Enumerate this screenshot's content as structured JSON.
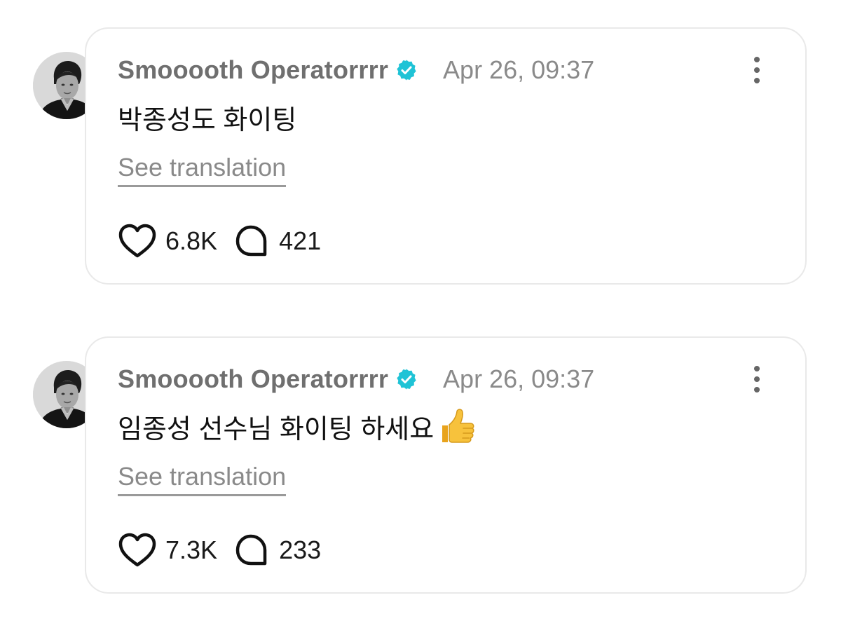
{
  "posts": [
    {
      "username": "Smooooth Operatorrrr",
      "timestamp": "Apr 26, 09:37",
      "text": "박종성도 화이팅",
      "has_emoji": false,
      "see_translation": "See translation",
      "likes": "6.8K",
      "replies": "421"
    },
    {
      "username": "Smooooth Operatorrrr",
      "timestamp": "Apr 26, 09:37",
      "text": "임종성 선수님 화이팅 하세요",
      "has_emoji": true,
      "emoji_name": "thumbs-up-emoji",
      "see_translation": "See translation",
      "likes": "7.3K",
      "replies": "233"
    }
  ],
  "icons": {
    "verified": "verified-badge-icon",
    "more": "more-options-icon",
    "like": "heart-icon",
    "reply": "comment-bubble-icon"
  },
  "colors": {
    "verified": "#1fc3d6",
    "username": "#6f6f6f",
    "meta": "#8a8a8a",
    "card_border": "#e9e9e9",
    "text": "#111111"
  }
}
